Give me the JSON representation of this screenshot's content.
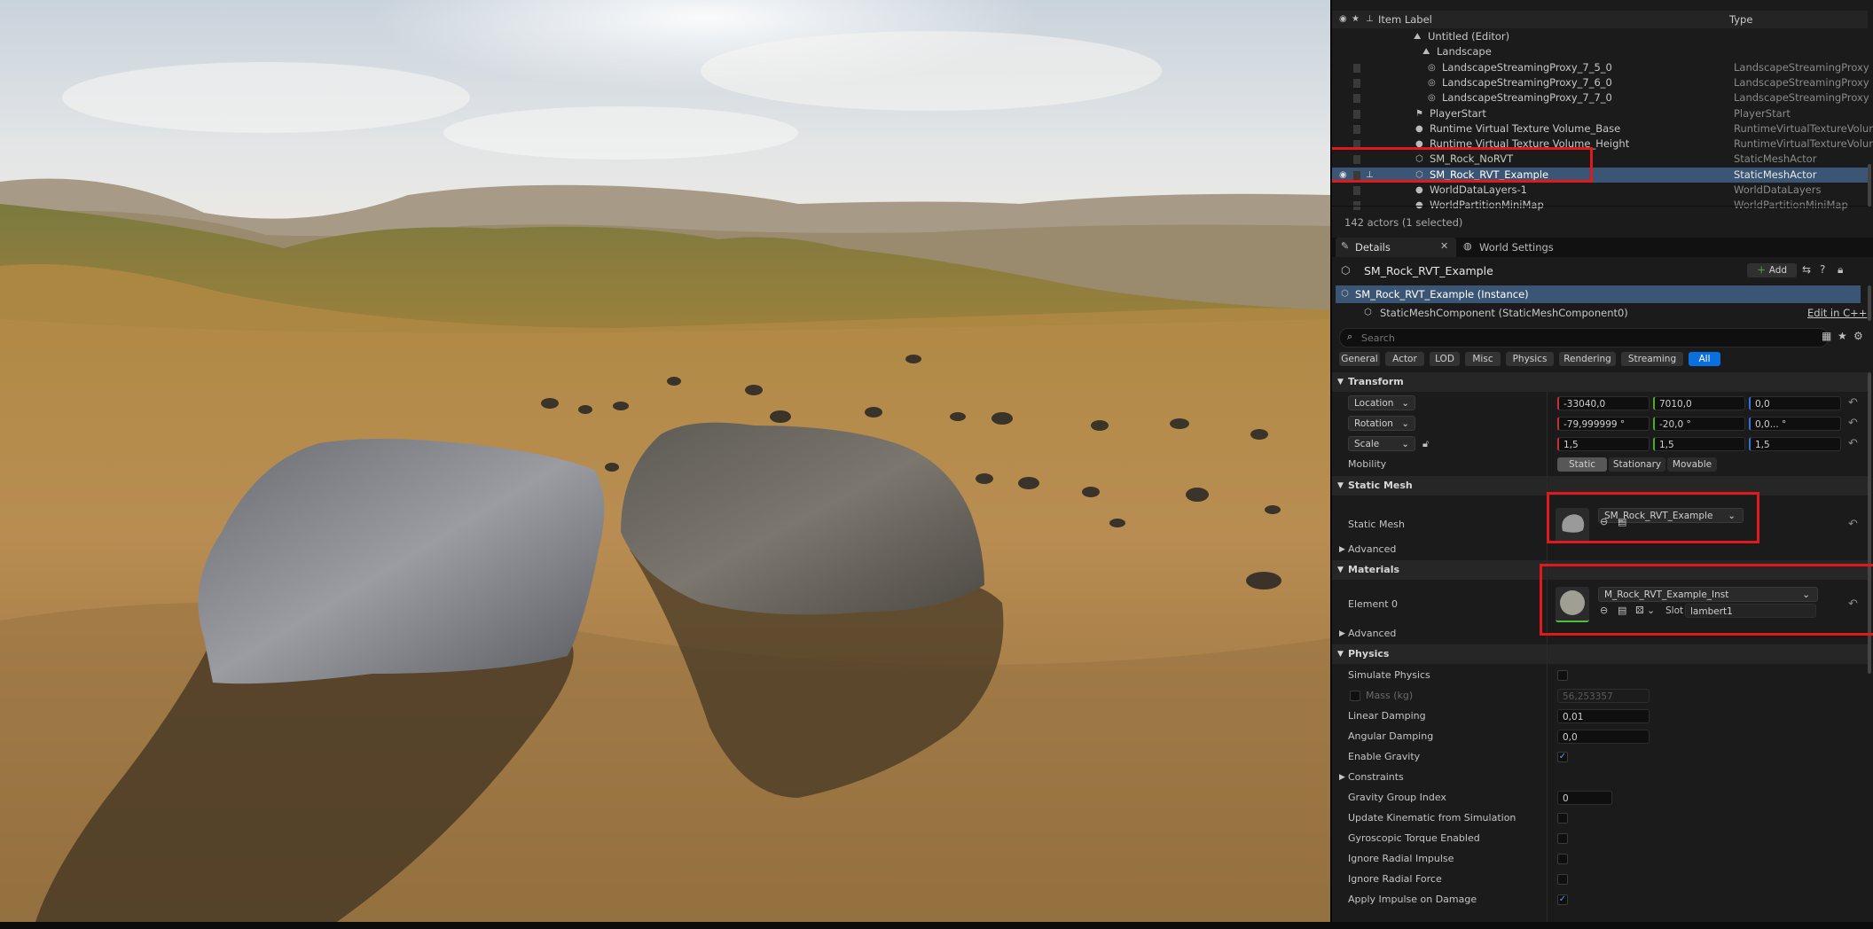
{
  "outliner": {
    "columns": {
      "label": "Item Label",
      "type": "Type"
    },
    "rows": [
      {
        "label": "Untitled (Editor)",
        "type": "",
        "icon": "world-icon"
      },
      {
        "label": "Landscape",
        "type": "",
        "icon": "landscape-icon"
      },
      {
        "label": "LandscapeStreamingProxy_7_5_0",
        "type": "LandscapeStreamingProxy",
        "icon": "proxy-icon"
      },
      {
        "label": "LandscapeStreamingProxy_7_6_0",
        "type": "LandscapeStreamingProxy",
        "icon": "proxy-icon"
      },
      {
        "label": "LandscapeStreamingProxy_7_7_0",
        "type": "LandscapeStreamingProxy",
        "icon": "proxy-icon"
      },
      {
        "label": "PlayerStart",
        "type": "PlayerStart",
        "icon": "player-start-icon"
      },
      {
        "label": "Runtime Virtual Texture Volume_Base",
        "type": "RuntimeVirtualTextureVolume",
        "icon": "actor-icon"
      },
      {
        "label": "Runtime Virtual Texture Volume_Height",
        "type": "RuntimeVirtualTextureVolume",
        "icon": "actor-icon"
      },
      {
        "label": "SM_Rock_NoRVT",
        "type": "StaticMeshActor",
        "icon": "static-mesh-icon"
      },
      {
        "label": "SM_Rock_RVT_Example",
        "type": "StaticMeshActor",
        "icon": "static-mesh-icon"
      },
      {
        "label": "WorldDataLayers-1",
        "type": "WorldDataLayers",
        "icon": "actor-icon"
      },
      {
        "label": "WorldPartitionMiniMap",
        "type": "WorldPartitionMiniMap",
        "icon": "actor-icon"
      }
    ],
    "status": "142 actors (1 selected)"
  },
  "tabs": {
    "details": "Details",
    "world_settings": "World Settings"
  },
  "details": {
    "actor_name": "SM_Rock_RVT_Example",
    "add_label": "Add",
    "instance_label": "SM_Rock_RVT_Example (Instance)",
    "component_label": "StaticMeshComponent (StaticMeshComponent0)",
    "edit_cpp": "Edit in C++",
    "search_placeholder": "Search",
    "filters": [
      "General",
      "Actor",
      "LOD",
      "Misc",
      "Physics",
      "Rendering",
      "Streaming",
      "All"
    ],
    "active_filter": "All"
  },
  "transform": {
    "title": "Transform",
    "location_label": "Location",
    "rotation_label": "Rotation",
    "scale_label": "Scale",
    "mobility_label": "Mobility",
    "location": [
      "-33040,0",
      "7010,0",
      "0,0"
    ],
    "rotation": [
      "-79,999999 °",
      "-20,0 °",
      "0,0... °"
    ],
    "scale": [
      "1,5",
      "1,5",
      "1,5"
    ],
    "mobility_options": [
      "Static",
      "Stationary",
      "Movable"
    ],
    "mobility_selected": "Static"
  },
  "static_mesh": {
    "title": "Static Mesh",
    "label": "Static Mesh",
    "value": "SM_Rock_RVT_Example",
    "advanced": "Advanced"
  },
  "materials": {
    "title": "Materials",
    "element_label": "Element 0",
    "value": "M_Rock_RVT_Example_Inst",
    "slot_label": "Slot",
    "slot_value": "lambert1",
    "advanced": "Advanced"
  },
  "physics": {
    "title": "Physics",
    "simulate": "Simulate Physics",
    "mass_label": "Mass (kg)",
    "mass_value": "56,253357",
    "linear_damping_label": "Linear Damping",
    "linear_damping": "0,01",
    "angular_damping_label": "Angular Damping",
    "angular_damping": "0,0",
    "enable_gravity": "Enable Gravity",
    "constraints": "Constraints",
    "gravity_group_label": "Gravity Group Index",
    "gravity_group": "0",
    "update_kinematic": "Update Kinematic from Simulation",
    "gyroscopic": "Gyroscopic Torque Enabled",
    "ignore_radial_impulse": "Ignore Radial Impulse",
    "ignore_radial_force": "Ignore Radial Force",
    "apply_impulse": "Apply Impulse on Damage"
  },
  "colors": {
    "selection": "#3b5675",
    "highlight": "#e0191d",
    "accent": "#0a70e0"
  }
}
